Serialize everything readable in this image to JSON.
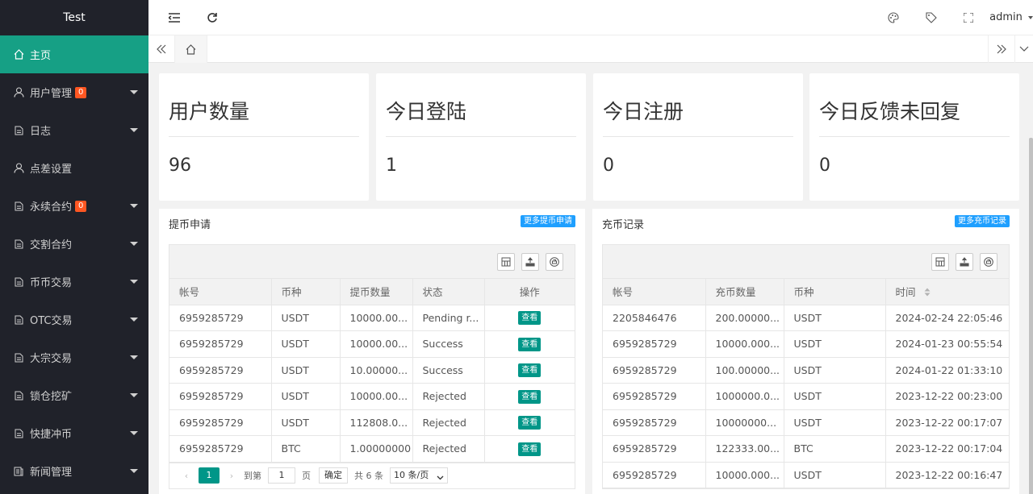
{
  "app": {
    "logo": "Test",
    "user": "admin"
  },
  "sidebar": {
    "items": [
      {
        "label": "主页",
        "icon": "home-icon",
        "badge": "",
        "caret": false,
        "active": true
      },
      {
        "label": "用户管理",
        "icon": "user-icon",
        "badge": "0",
        "caret": true,
        "active": false
      },
      {
        "label": "日志",
        "icon": "document-icon",
        "badge": "",
        "caret": true,
        "active": false
      },
      {
        "label": "点差设置",
        "icon": "user-icon",
        "badge": "",
        "caret": false,
        "active": false
      },
      {
        "label": "永续合约",
        "icon": "document-icon",
        "badge": "0",
        "caret": true,
        "active": false
      },
      {
        "label": "交割合约",
        "icon": "document-icon",
        "badge": "",
        "caret": true,
        "active": false
      },
      {
        "label": "币币交易",
        "icon": "document-icon",
        "badge": "",
        "caret": true,
        "active": false
      },
      {
        "label": "OTC交易",
        "icon": "document-icon",
        "badge": "",
        "caret": true,
        "active": false
      },
      {
        "label": "大宗交易",
        "icon": "document-icon",
        "badge": "",
        "caret": true,
        "active": false
      },
      {
        "label": "锁仓挖矿",
        "icon": "document-icon",
        "badge": "",
        "caret": true,
        "active": false
      },
      {
        "label": "快捷冲币",
        "icon": "document-icon",
        "badge": "",
        "caret": true,
        "active": false
      },
      {
        "label": "新闻管理",
        "icon": "news-icon",
        "badge": "",
        "caret": true,
        "active": false
      }
    ]
  },
  "stats": [
    {
      "title": "用户数量",
      "value": "96"
    },
    {
      "title": "今日登陆",
      "value": "1"
    },
    {
      "title": "今日注册",
      "value": "0"
    },
    {
      "title": "今日反馈未回复",
      "value": "0"
    }
  ],
  "withdraw": {
    "title": "提币申请",
    "more": "更多提币申请",
    "headers": [
      "帐号",
      "币种",
      "提币数量",
      "状态",
      "操作"
    ],
    "action_label": "查看",
    "rows": [
      [
        "6959285729",
        "USDT",
        "10000.00...",
        "Pending r..."
      ],
      [
        "6959285729",
        "USDT",
        "10000.00...",
        "Success"
      ],
      [
        "6959285729",
        "USDT",
        "10.00000...",
        "Success"
      ],
      [
        "6959285729",
        "USDT",
        "10000.00...",
        "Rejected"
      ],
      [
        "6959285729",
        "USDT",
        "112808.0...",
        "Rejected"
      ],
      [
        "6959285729",
        "BTC",
        "1.00000000",
        "Rejected"
      ]
    ],
    "pager": {
      "current": "1",
      "goto_label": "到第",
      "goto_value": "1",
      "page_label": "页",
      "ok_label": "确定",
      "total": "共 6 条",
      "size": "10 条/页"
    }
  },
  "deposit": {
    "title": "充币记录",
    "more": "更多充币记录",
    "headers": [
      "帐号",
      "充币数量",
      "币种",
      "时间"
    ],
    "rows": [
      [
        "2205846476",
        "200.00000...",
        "USDT",
        "2024-02-24 22:05:46"
      ],
      [
        "6959285729",
        "10000.000...",
        "USDT",
        "2024-01-23 00:55:54"
      ],
      [
        "6959285729",
        "100.00000...",
        "USDT",
        "2024-01-22 01:33:10"
      ],
      [
        "6959285729",
        "1000000.0...",
        "USDT",
        "2023-12-22 00:23:00"
      ],
      [
        "6959285729",
        "10000000...",
        "USDT",
        "2023-12-22 00:17:07"
      ],
      [
        "6959285729",
        "122333.00...",
        "BTC",
        "2023-12-22 00:17:04"
      ],
      [
        "6959285729",
        "10000.000...",
        "USDT",
        "2023-12-22 00:16:47"
      ]
    ]
  },
  "colors": {
    "sidebar_bg": "#20222a",
    "active": "#16a085",
    "badge": "#ff5722",
    "primary": "#009688",
    "info": "#1e9fff"
  }
}
